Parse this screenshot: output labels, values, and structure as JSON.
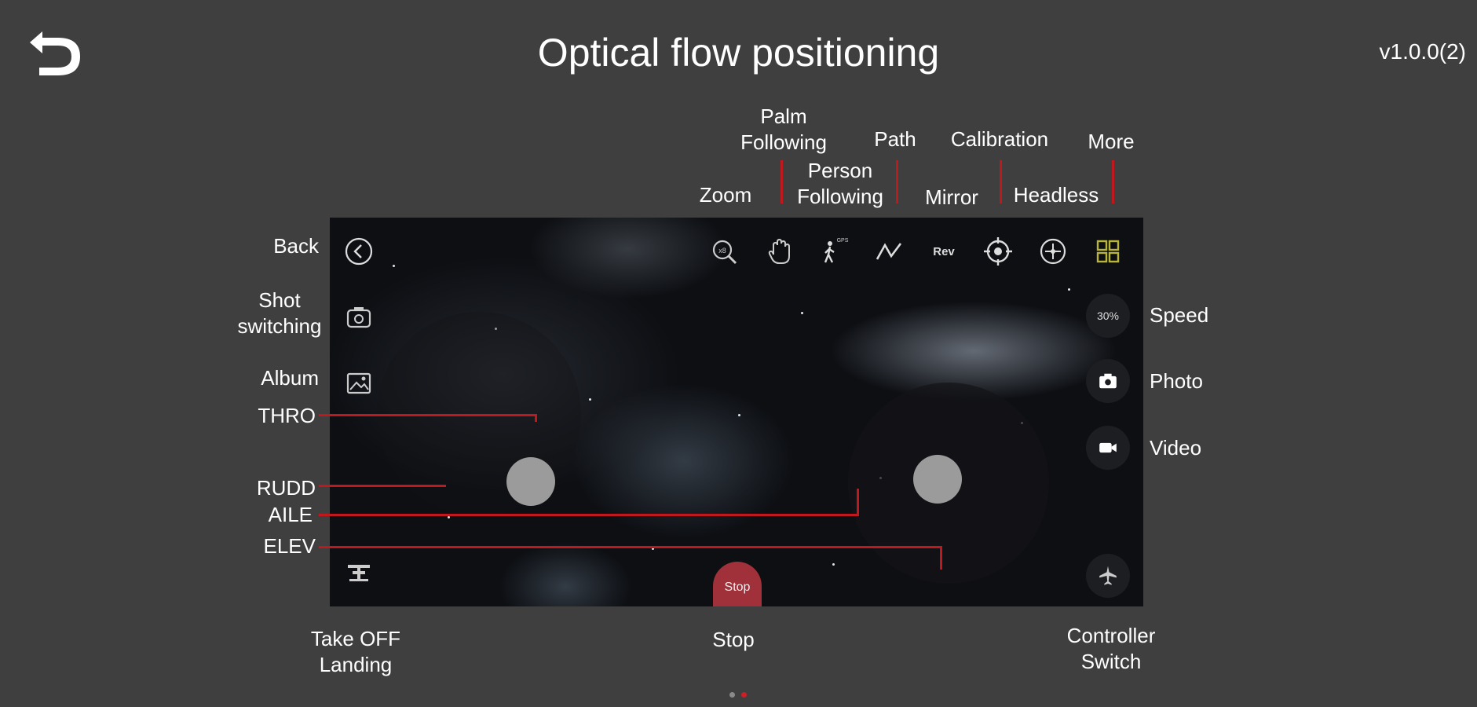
{
  "header": {
    "title": "Optical flow positioning",
    "version": "v1.0.0(2)"
  },
  "labels": {
    "palm_following": [
      "Palm",
      "Following"
    ],
    "path": "Path",
    "calibration": "Calibration",
    "more": "More",
    "zoom": "Zoom",
    "person_following": [
      "Person",
      "Following"
    ],
    "mirror": "Mirror",
    "headless": "Headless",
    "back": "Back",
    "shot_switching": [
      "Shot",
      "switching"
    ],
    "album": "Album",
    "thro": "THRO",
    "rudd": "RUDD",
    "aile": "AILE",
    "elev": "ELEV",
    "speed": "Speed",
    "photo": "Photo",
    "video": "Video",
    "take_off_landing": [
      "Take OFF",
      "Landing"
    ],
    "stop": "Stop",
    "controller_switch": [
      "Controller",
      "Switch"
    ]
  },
  "screen": {
    "rev_label": "Rev",
    "speed_value": "30%",
    "stop_label": "Stop",
    "icons": [
      "back-circle-icon",
      "camera-switch-icon",
      "album-icon",
      "zoom-icon",
      "palm-icon",
      "person-following-icon",
      "path-icon",
      "rev-mirror-icon",
      "calibration-icon",
      "headless-icon",
      "more-grid-icon",
      "photo-camera-icon",
      "video-camera-icon",
      "takeoff-landing-icon",
      "controller-switch-icon"
    ]
  },
  "pager": {
    "pages": 2,
    "active": 2
  },
  "colors": {
    "background": "#3f3f3f",
    "accent_red": "#c0181d",
    "grid_icon": "#b9b43a",
    "stop_button": "#a0303a"
  }
}
